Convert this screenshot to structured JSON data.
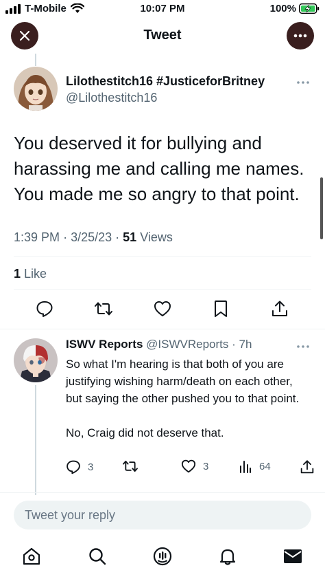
{
  "status_bar": {
    "carrier": "T-Mobile",
    "time": "10:07 PM",
    "battery": "100%"
  },
  "header": {
    "title": "Tweet",
    "close_icon": "close-icon",
    "more_icon": "more-horizontal-icon"
  },
  "tweet": {
    "author_name": "Lilothestitch16 #JusticeforBritney",
    "author_handle": "@Lilothestitch16",
    "text": "You deserved it for bullying and harassing me and calling me names. You made me so angry to that point.",
    "time": "1:39 PM",
    "date": "3/25/23",
    "views_count": "51",
    "views_label": "Views",
    "likes_count": "1",
    "likes_label": "Like"
  },
  "reply": {
    "author_name": "ISWV Reports",
    "author_handle": "@ISWVReports",
    "age": "7h",
    "text": "So what I'm hearing is that both of you are justifying wishing harm/death on each other, but saying the other pushed you to that point.\n\nNo, Craig did not deserve that.",
    "replies": "3",
    "likes": "3",
    "views": "64"
  },
  "composer": {
    "placeholder": "Tweet your reply"
  },
  "colors": {
    "header_button_bg": "#3a1f1f",
    "secondary_text": "#536471",
    "divider": "#eff3f4",
    "battery_green": "#34c759"
  }
}
